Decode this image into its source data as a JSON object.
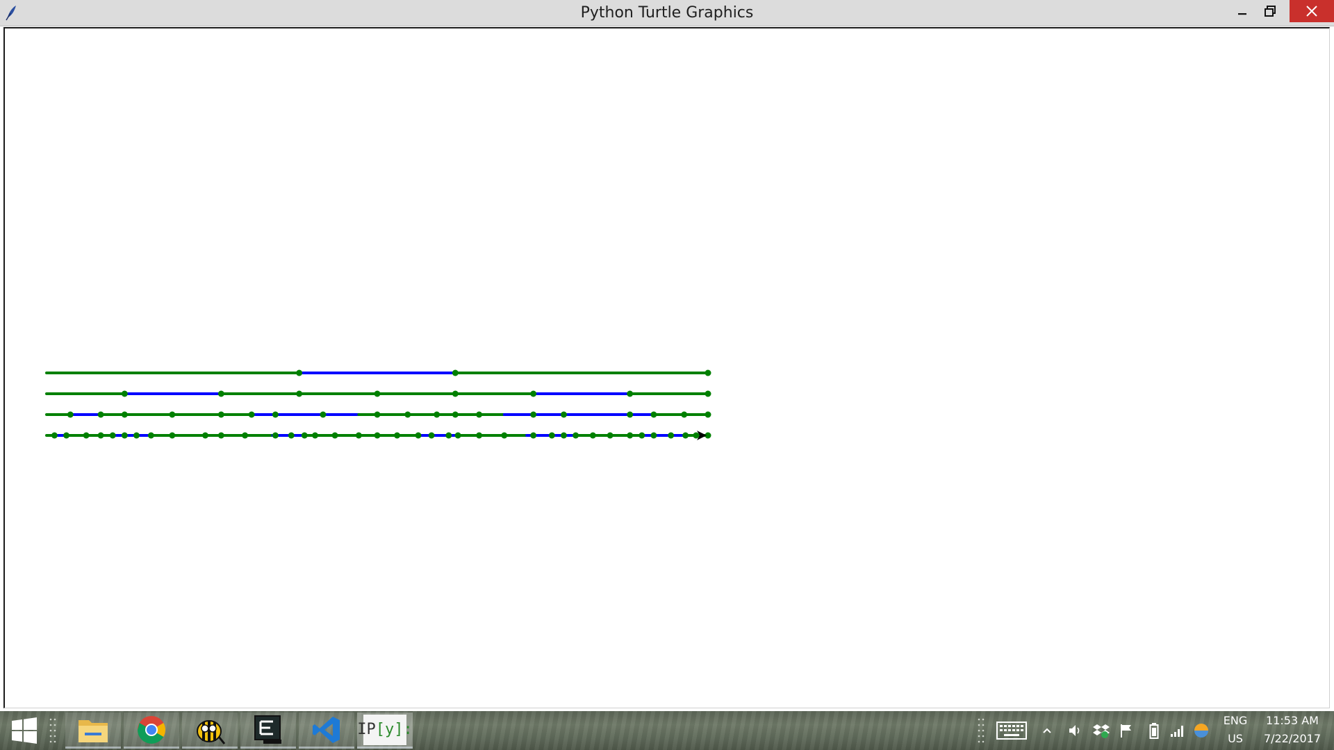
{
  "window": {
    "title": "Python Turtle Graphics"
  },
  "icons": {
    "app": "feather-icon",
    "minimize": "minimize-icon",
    "maximize": "restore-icon",
    "close": "close-icon"
  },
  "drawing": {
    "colors": {
      "segment_a": "#008000",
      "segment_b": "#0000ff",
      "dot": "#008000",
      "turtle": "#000000"
    },
    "description_lines": 4,
    "rows": [
      {
        "segments": [
          [
            "a",
            0,
            0.382
          ],
          [
            "b",
            0.382,
            0.618
          ],
          [
            "a",
            0.618,
            1
          ]
        ],
        "dots": [
          0.382,
          0.618,
          1
        ]
      },
      {
        "segments": [
          [
            "a",
            0,
            0.118
          ],
          [
            "b",
            0.118,
            0.264
          ],
          [
            "a",
            0.264,
            0.736
          ],
          [
            "b",
            0.736,
            0.882
          ],
          [
            "a",
            0.882,
            1
          ]
        ],
        "dots": [
          0.118,
          0.264,
          0.382,
          0.5,
          0.618,
          0.736,
          0.882,
          1
        ]
      },
      {
        "segments": [
          [
            "a",
            0,
            0.036
          ],
          [
            "b",
            0.036,
            0.082
          ],
          [
            "a",
            0.082,
            0.31
          ],
          [
            "b",
            0.31,
            0.472
          ],
          [
            "a",
            0.472,
            0.692
          ],
          [
            "b",
            0.692,
            0.918
          ],
          [
            "a",
            0.918,
            1
          ]
        ],
        "dots": [
          0.036,
          0.082,
          0.118,
          0.19,
          0.264,
          0.31,
          0.346,
          0.418,
          0.5,
          0.546,
          0.59,
          0.618,
          0.654,
          0.736,
          0.782,
          0.882,
          0.918,
          0.964,
          1
        ]
      },
      {
        "segments": [
          [
            "a",
            0,
            0.012
          ],
          [
            "b",
            0.012,
            0.03
          ],
          [
            "a",
            0.03,
            0.1
          ],
          [
            "b",
            0.1,
            0.158
          ],
          [
            "a",
            0.158,
            0.342
          ],
          [
            "b",
            0.342,
            0.39
          ],
          [
            "a",
            0.39,
            0.562
          ],
          [
            "b",
            0.562,
            0.622
          ],
          [
            "a",
            0.622,
            0.726
          ],
          [
            "b",
            0.726,
            0.8
          ],
          [
            "a",
            0.8,
            0.9
          ],
          [
            "b",
            0.9,
            0.966
          ],
          [
            "a",
            0.966,
            1
          ]
        ],
        "dots": [
          0.012,
          0.03,
          0.06,
          0.082,
          0.1,
          0.118,
          0.136,
          0.158,
          0.19,
          0.24,
          0.264,
          0.3,
          0.346,
          0.37,
          0.39,
          0.406,
          0.436,
          0.472,
          0.5,
          0.53,
          0.562,
          0.582,
          0.608,
          0.622,
          0.654,
          0.692,
          0.736,
          0.764,
          0.782,
          0.8,
          0.826,
          0.852,
          0.882,
          0.9,
          0.918,
          0.944,
          0.966,
          0.982,
          1
        ]
      }
    ]
  },
  "taskbar": {
    "apps": [
      {
        "name": "file-explorer-icon",
        "active": false
      },
      {
        "name": "chrome-icon",
        "active": false
      },
      {
        "name": "bee-app-icon",
        "active": false
      },
      {
        "name": "terminal-icon",
        "active": false
      },
      {
        "name": "vscode-icon",
        "active": false
      },
      {
        "name": "ipython-icon",
        "active": true,
        "label_left": "IP",
        "label_mid": "[y]:"
      }
    ],
    "tray": {
      "language_top": "ENG",
      "language_bottom": "US",
      "time": "11:53 AM",
      "date": "7/22/2017"
    }
  }
}
